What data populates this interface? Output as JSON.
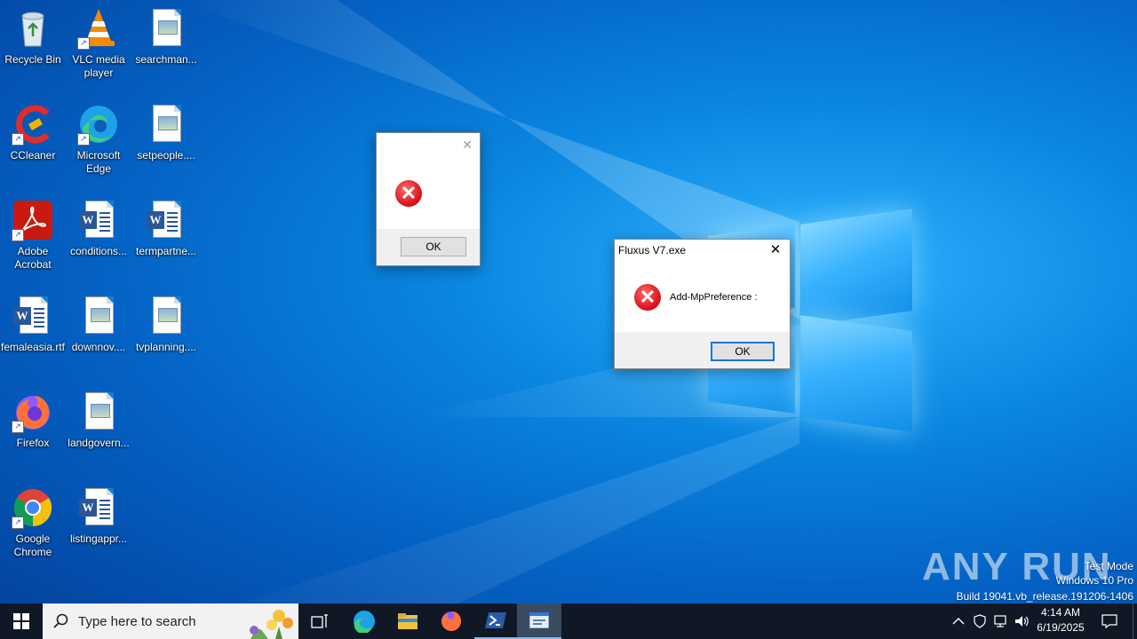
{
  "desktop": {
    "icons": [
      {
        "label": "Recycle Bin"
      },
      {
        "label": "VLC media player"
      },
      {
        "label": "searchman..."
      },
      {
        "label": "CCleaner"
      },
      {
        "label": "Microsoft Edge"
      },
      {
        "label": "setpeople...."
      },
      {
        "label": "Adobe Acrobat"
      },
      {
        "label": "conditions..."
      },
      {
        "label": "termpartne..."
      },
      {
        "label": "femaleasia.rtf"
      },
      {
        "label": "downnov...."
      },
      {
        "label": "tvplanning...."
      },
      {
        "label": "Firefox"
      },
      {
        "label": "landgovern..."
      },
      {
        "label": "Google Chrome"
      },
      {
        "label": "listingappr..."
      }
    ]
  },
  "dialog_small": {
    "ok_label": "OK",
    "close_glyph": "✕"
  },
  "dialog_main": {
    "title": "Fluxus V7.exe",
    "message": "Add-MpPreference :",
    "ok_label": "OK",
    "close_glyph": "✕"
  },
  "watermark": {
    "brand": "ANY RUN",
    "line1": "Test Mode",
    "line2": "Windows 10 Pro",
    "line3": "Build 19041.vb_release.191206-1406"
  },
  "taskbar": {
    "search_placeholder": "Type here to search",
    "clock_time": "4:14 AM",
    "clock_date": "6/19/2025",
    "icons": [
      "windows-start-icon",
      "task-view-icon",
      "edge-icon",
      "file-explorer-icon",
      "firefox-icon",
      "powershell-icon",
      "error-window-icon"
    ]
  }
}
